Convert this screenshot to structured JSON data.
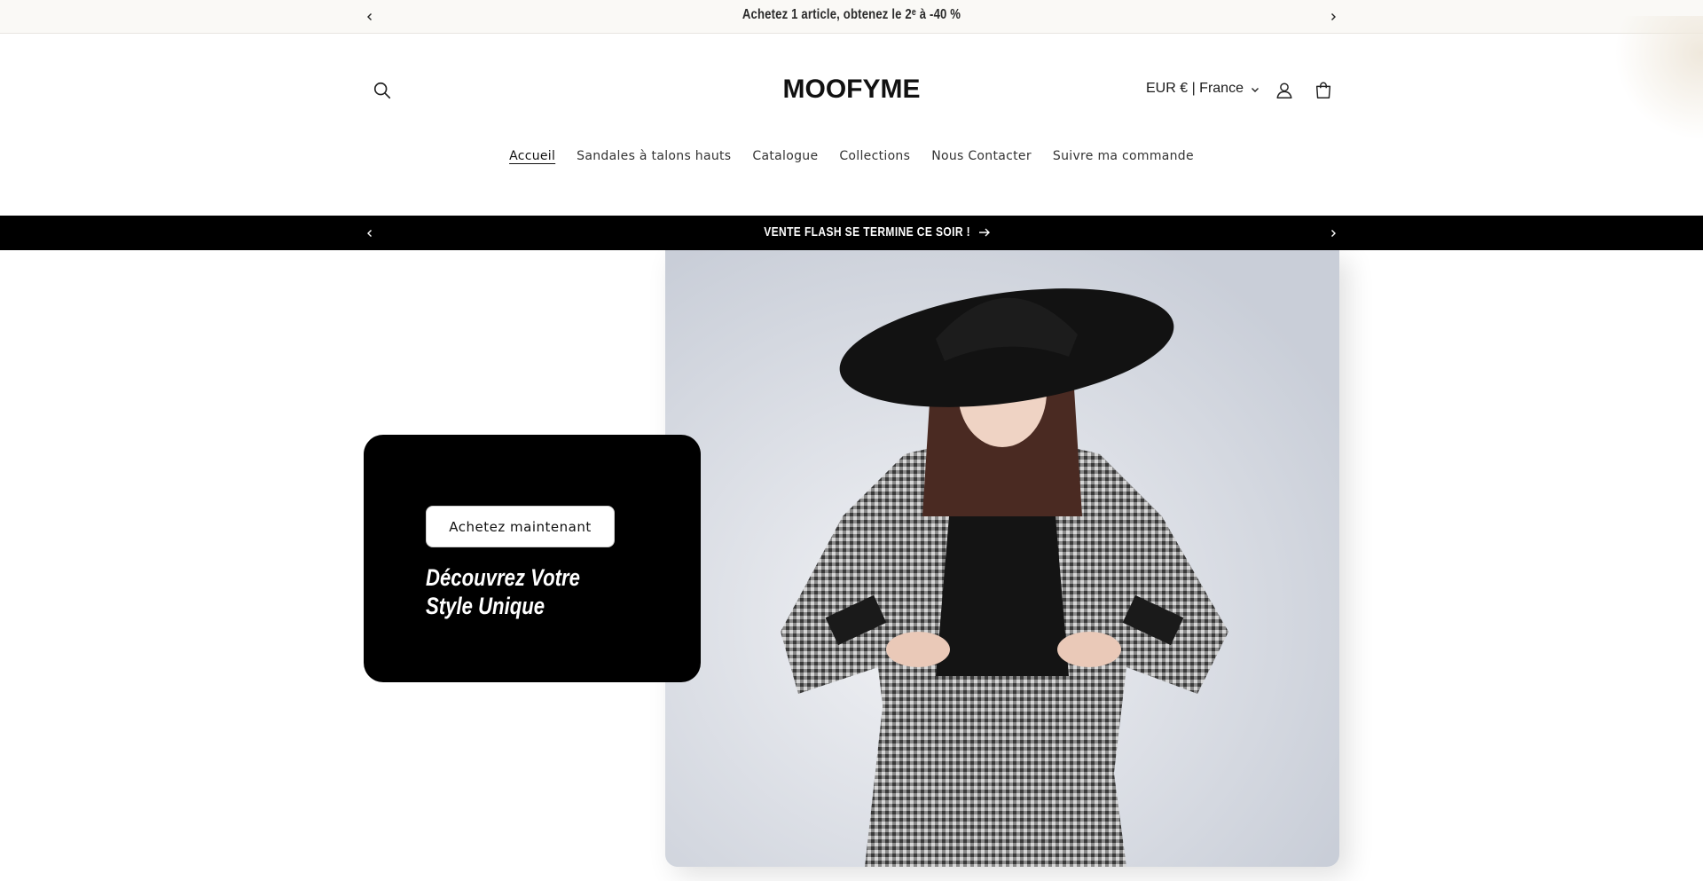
{
  "announcement": {
    "text": "Achetez 1 article, obtenez le 2ᵉ à -40 %",
    "prev_icon": "chevron-left-icon",
    "next_icon": "chevron-right-icon"
  },
  "header": {
    "logo": "MOOFYME",
    "currency": "EUR € | France",
    "icons": [
      "search-icon",
      "account-icon",
      "cart-icon",
      "chevron-down-icon"
    ]
  },
  "nav": {
    "items": [
      {
        "label": "Accueil",
        "active": true
      },
      {
        "label": "Sandales à talons hauts"
      },
      {
        "label": "Catalogue"
      },
      {
        "label": "Collections"
      },
      {
        "label": "Nous Contacter"
      },
      {
        "label": "Suivre ma commande"
      }
    ]
  },
  "flash": {
    "text": "VENTE FLASH SE TERMINE CE SOIR !",
    "icon": "arrow-right-icon"
  },
  "hero": {
    "button_label": "Achetez maintenant",
    "title": "Découvrez Votre Style Unique"
  },
  "colors": {
    "bar_bg": "#000000",
    "top_bar_bg": "#faf9f6",
    "text": "#1a1a1a"
  }
}
